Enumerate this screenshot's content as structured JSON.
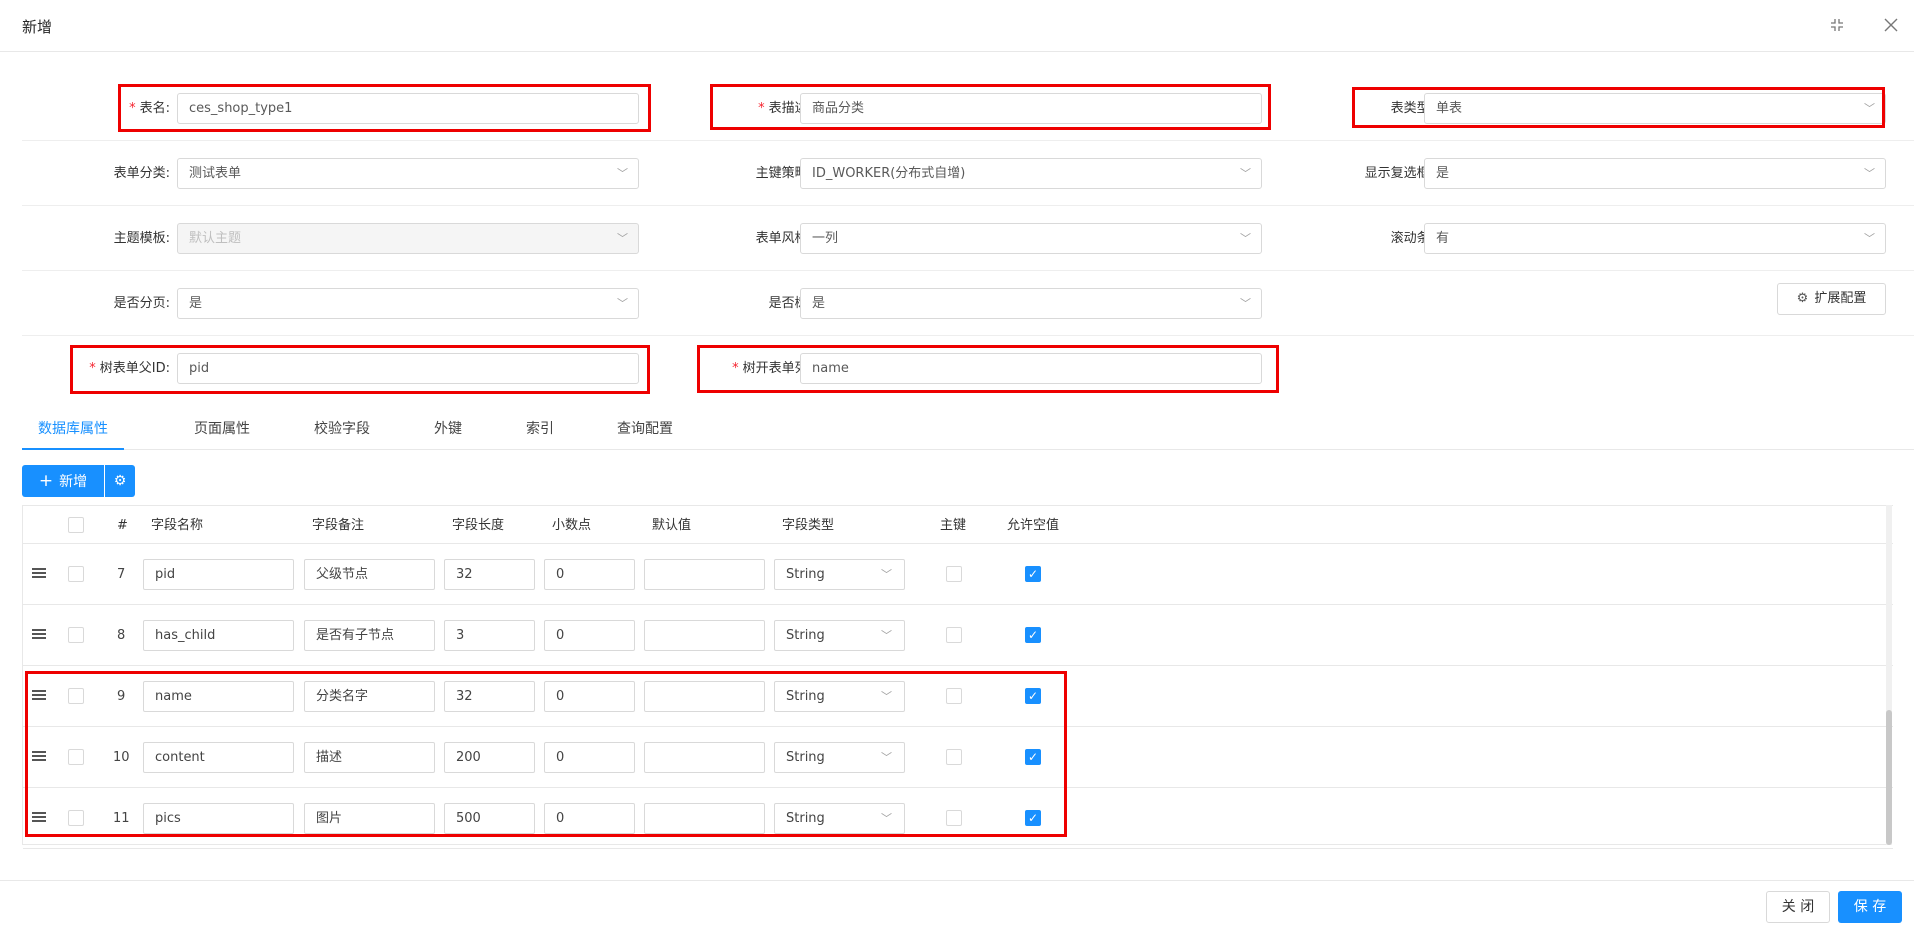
{
  "window": {
    "title": "新增",
    "minimize_icon": "shrink-icon",
    "close_icon": "close-icon"
  },
  "form": {
    "table_name": {
      "label": "表名:",
      "required": "*",
      "value": "ces_shop_type1"
    },
    "table_desc": {
      "label": "表描述:",
      "required": "*",
      "value": "商品分类"
    },
    "table_type": {
      "label": "表类型:",
      "required": "*",
      "value": "单表"
    },
    "form_category": {
      "label": "表单分类:",
      "value": "测试表单"
    },
    "pk_strategy": {
      "label": "主键策略:",
      "value": "ID_WORKER(分布式自增)"
    },
    "show_checkbox": {
      "label": "显示复选框:",
      "value": "是"
    },
    "theme_template": {
      "label": "主题模板:",
      "value": "默认主题"
    },
    "form_style": {
      "label": "表单风格:",
      "value": "一列"
    },
    "scrollbar": {
      "label": "滚动条:",
      "value": "有"
    },
    "pagination": {
      "label": "是否分页:",
      "value": "是"
    },
    "is_tree": {
      "label": "是否树:",
      "value": "是"
    },
    "ext_config": {
      "label": "扩展配置"
    },
    "tree_parent_id": {
      "label": "树表单父ID:",
      "required": "*",
      "value": "pid"
    },
    "tree_open_column": {
      "label": "树开表单列:",
      "required": "*",
      "value": "name"
    }
  },
  "tabs": [
    {
      "label": "数据库属性",
      "active": true
    },
    {
      "label": "页面属性"
    },
    {
      "label": "校验字段"
    },
    {
      "label": "外键"
    },
    {
      "label": "索引"
    },
    {
      "label": "查询配置"
    }
  ],
  "toolbar": {
    "add_label": "新增",
    "add_icon": "+"
  },
  "table": {
    "headers": [
      "#",
      "字段名称",
      "字段备注",
      "字段长度",
      "小数点",
      "默认值",
      "字段类型",
      "主键",
      "允许空值"
    ],
    "rows": [
      {
        "num": "7",
        "name": "pid",
        "remark": "父级节点",
        "length": "32",
        "decimal": "0",
        "default": "",
        "type": "String",
        "pk": false,
        "nullable": true
      },
      {
        "num": "8",
        "name": "has_child",
        "remark": "是否有子节点",
        "length": "3",
        "decimal": "0",
        "default": "",
        "type": "String",
        "pk": false,
        "nullable": true
      },
      {
        "num": "9",
        "name": "name",
        "remark": "分类名字",
        "length": "32",
        "decimal": "0",
        "default": "",
        "type": "String",
        "pk": false,
        "nullable": true
      },
      {
        "num": "10",
        "name": "content",
        "remark": "描述",
        "length": "200",
        "decimal": "0",
        "default": "",
        "type": "String",
        "pk": false,
        "nullable": true
      },
      {
        "num": "11",
        "name": "pics",
        "remark": "图片",
        "length": "500",
        "decimal": "0",
        "default": "",
        "type": "String",
        "pk": false,
        "nullable": true
      }
    ]
  },
  "footer": {
    "close_label": "关 闭",
    "save_label": "保 存"
  },
  "colors": {
    "accent": "#1890ff",
    "highlight_box": "#ee0000",
    "required_star": "#f5222d"
  }
}
